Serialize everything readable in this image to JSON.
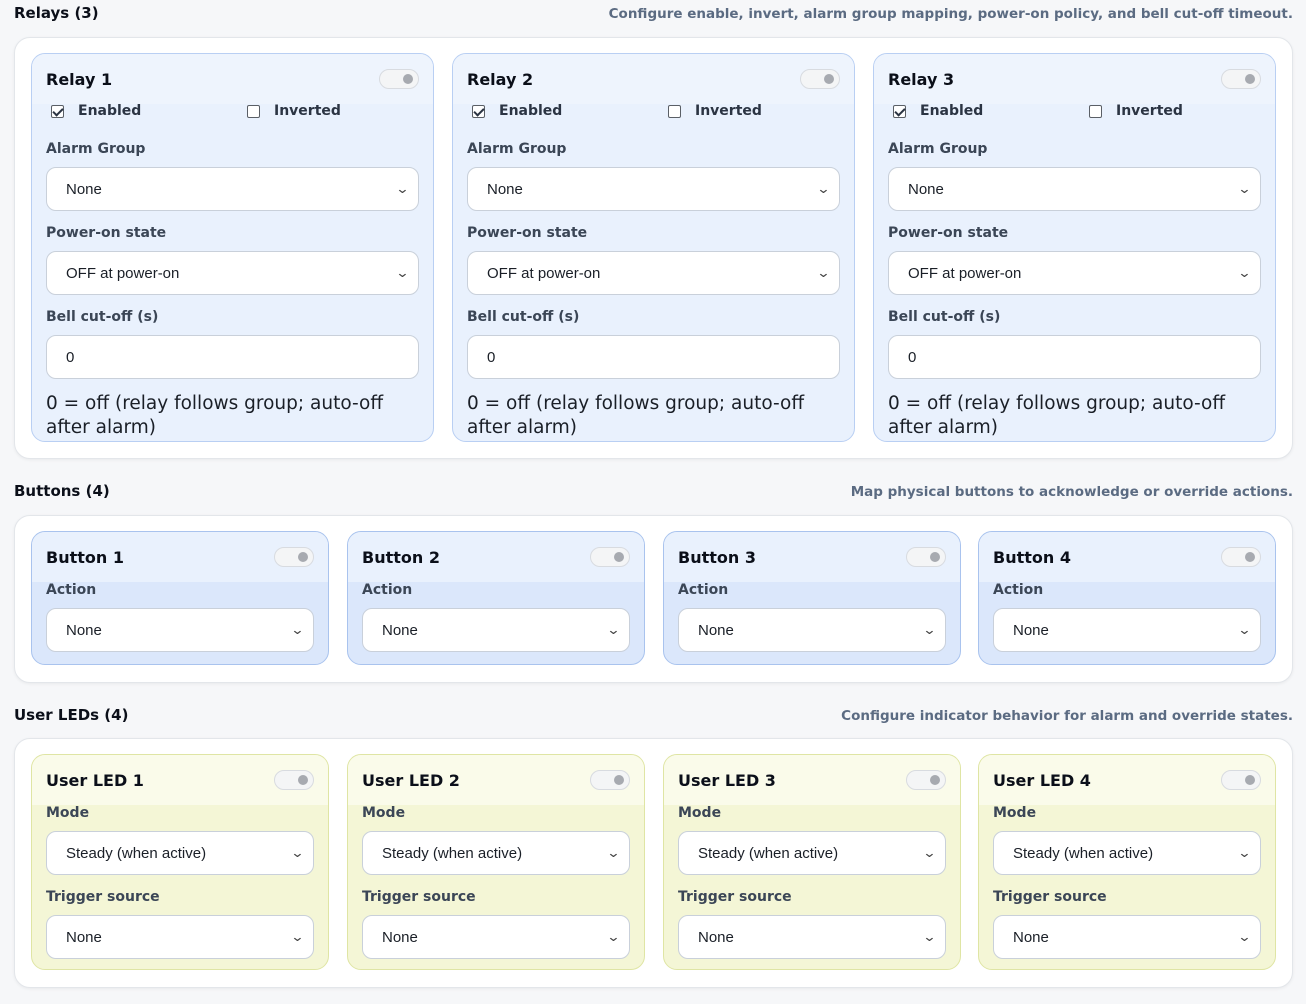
{
  "relays": {
    "title": "Relays (3)",
    "subtitle": "Configure enable, invert, alarm group mapping, power-on policy, and bell cut-off timeout.",
    "items": [
      {
        "title": "Relay 1",
        "enabled_label": "Enabled",
        "enabled": true,
        "inverted_label": "Inverted",
        "inverted": false,
        "alarm_group_label": "Alarm Group",
        "alarm_group": "None",
        "power_on_label": "Power-on state",
        "power_on": "OFF at power-on",
        "bell_label": "Bell cut-off (s)",
        "bell_value": "0",
        "hint": "0 = off (relay follows group; auto-off after alarm)"
      },
      {
        "title": "Relay 2",
        "enabled_label": "Enabled",
        "enabled": true,
        "inverted_label": "Inverted",
        "inverted": false,
        "alarm_group_label": "Alarm Group",
        "alarm_group": "None",
        "power_on_label": "Power-on state",
        "power_on": "OFF at power-on",
        "bell_label": "Bell cut-off (s)",
        "bell_value": "0",
        "hint": "0 = off (relay follows group; auto-off after alarm)"
      },
      {
        "title": "Relay 3",
        "enabled_label": "Enabled",
        "enabled": true,
        "inverted_label": "Inverted",
        "inverted": false,
        "alarm_group_label": "Alarm Group",
        "alarm_group": "None",
        "power_on_label": "Power-on state",
        "power_on": "OFF at power-on",
        "bell_label": "Bell cut-off (s)",
        "bell_value": "0",
        "hint": "0 = off (relay follows group; auto-off after alarm)"
      }
    ]
  },
  "buttons": {
    "title": "Buttons (4)",
    "subtitle": "Map physical buttons to acknowledge or override actions.",
    "items": [
      {
        "title": "Button 1",
        "action_label": "Action",
        "action": "None"
      },
      {
        "title": "Button 2",
        "action_label": "Action",
        "action": "None"
      },
      {
        "title": "Button 3",
        "action_label": "Action",
        "action": "None"
      },
      {
        "title": "Button 4",
        "action_label": "Action",
        "action": "None"
      }
    ]
  },
  "leds": {
    "title": "User LEDs (4)",
    "subtitle": "Configure indicator behavior for alarm and override states.",
    "items": [
      {
        "title": "User LED 1",
        "mode_label": "Mode",
        "mode": "Steady (when active)",
        "trigger_label": "Trigger source",
        "trigger": "None"
      },
      {
        "title": "User LED 2",
        "mode_label": "Mode",
        "mode": "Steady (when active)",
        "trigger_label": "Trigger source",
        "trigger": "None"
      },
      {
        "title": "User LED 3",
        "mode_label": "Mode",
        "mode": "Steady (when active)",
        "trigger_label": "Trigger source",
        "trigger": "None"
      },
      {
        "title": "User LED 4",
        "mode_label": "Mode",
        "mode": "Steady (when active)",
        "trigger_label": "Trigger source",
        "trigger": "None"
      }
    ]
  },
  "icons": {
    "chevron": "chevron-down-icon",
    "toggle": "toggle-switch",
    "checkbox": "checkbox"
  },
  "colors": {
    "relay_card": "#e9f1fd",
    "button_card": "#dbe7fb",
    "led_card": "#f4f6d6"
  }
}
